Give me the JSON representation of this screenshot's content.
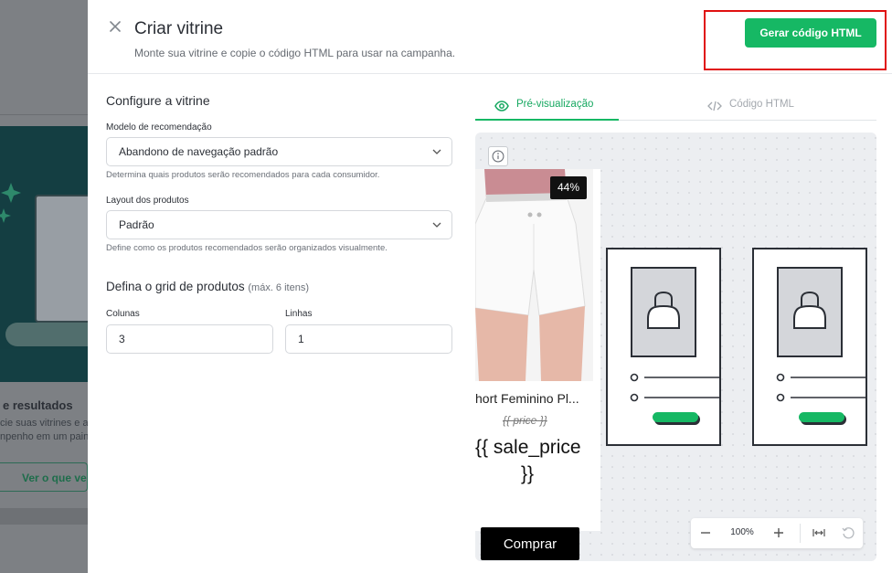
{
  "background": {
    "heading": "e resultados",
    "text_line1": "cie suas vitrines e a",
    "text_line2": "npenho em um pain",
    "link": "Ver o que ve"
  },
  "modal": {
    "title": "Criar vitrine",
    "subtitle": "Monte sua vitrine e copie o código HTML para usar na campanha.",
    "generate_button": "Gerar código HTML"
  },
  "config": {
    "section_title": "Configure a vitrine",
    "model_label": "Modelo de recomendação",
    "model_value": "Abandono de navegação padrão",
    "model_help": "Determina quais produtos serão recomendados para cada consumidor.",
    "layout_label": "Layout dos produtos",
    "layout_value": "Padrão",
    "layout_help": "Define como os produtos recomendados serão organizados visualmente.",
    "grid_title": "Defina o grid de produtos",
    "grid_max": "(máx. 6 itens)",
    "columns_label": "Colunas",
    "columns_value": "3",
    "rows_label": "Linhas",
    "rows_value": "1"
  },
  "tabs": [
    {
      "label": "Pré-visualização",
      "icon": "eye-icon",
      "active": true
    },
    {
      "label": "Código HTML",
      "icon": "code-icon",
      "active": false
    }
  ],
  "preview": {
    "discount": "44%",
    "product_name": "hort Feminino Pl...",
    "price": "{{ price }}",
    "sale_price_line1": "{{ sale_price",
    "sale_price_line2": "}}",
    "buy_button": "Comprar",
    "zoom_level": "100%"
  },
  "colors": {
    "accent": "#16b864",
    "highlight": "#e01010"
  }
}
